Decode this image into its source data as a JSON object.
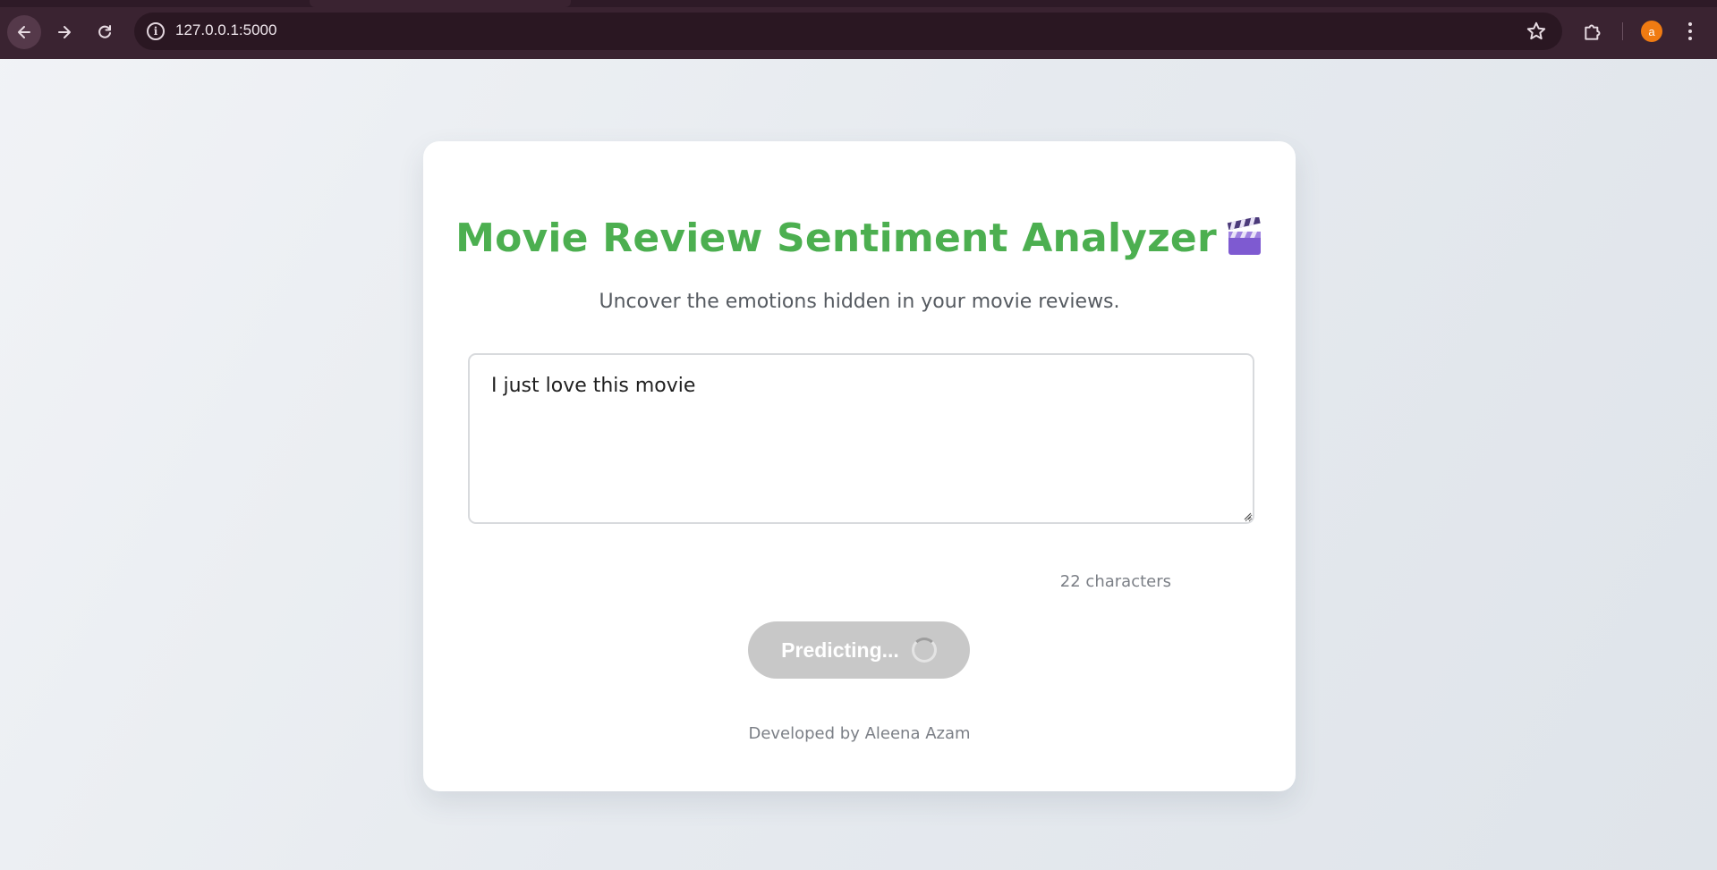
{
  "browser": {
    "url": "127.0.0.1:5000",
    "avatar_letter": "a",
    "icons": {
      "back": "arrow-left-icon",
      "forward": "arrow-right-icon",
      "reload": "reload-icon",
      "site_info": "info-icon",
      "bookmark": "star-icon",
      "extensions": "puzzle-icon",
      "menu": "kebab-menu-icon"
    },
    "colors": {
      "chrome": "#3a2331",
      "avatar": "#f07b12"
    }
  },
  "app": {
    "title": "Movie Review Sentiment Analyzer",
    "title_icon": "clapperboard-icon",
    "subtitle": "Uncover the emotions hidden in your movie reviews.",
    "review_text": "I just love this movie",
    "char_count": "22 characters",
    "predict_button_label": "Predicting...",
    "predict_button_state": "loading",
    "footer": "Developed by Aleena Azam",
    "colors": {
      "title": "#4caf50",
      "button_disabled": "#c8c8c8"
    }
  }
}
